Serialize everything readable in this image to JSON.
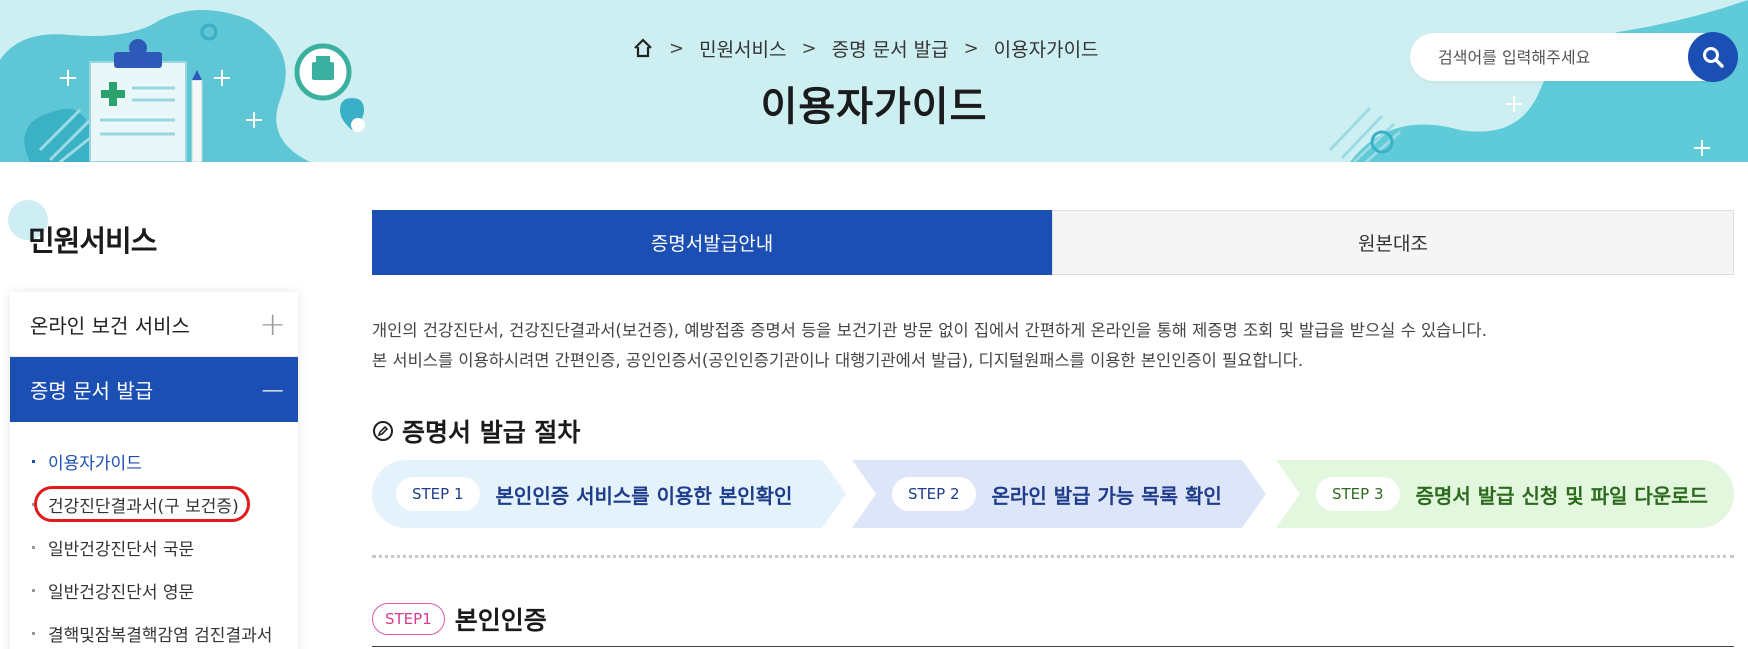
{
  "header": {
    "breadcrumb": [
      "민원서비스",
      "증명 문서 발급",
      "이용자가이드"
    ],
    "title": "이용자가이드",
    "search_placeholder": "검색어를 입력해주세요"
  },
  "sidebar": {
    "title": "민원서비스",
    "items": [
      {
        "label": "온라인 보건 서비스",
        "toggle": "+"
      },
      {
        "label": "증명 문서 발급",
        "toggle": "−"
      }
    ],
    "sub_items": [
      "이용자가이드",
      "건강진단결과서(구 보건증)",
      "일반건강진단서 국문",
      "일반건강진단서 영문",
      "결핵및잠복결핵감염 검진결과서"
    ]
  },
  "tabs": [
    "증명서발급안내",
    "원본대조"
  ],
  "intro": [
    "개인의 건강진단서, 건강진단결과서(보건증), 예방접종 증명서 등을 보건기관 방문 없이 집에서 간편하게 온라인을 통해 제증명 조회 및 발급을 받으실 수 있습니다.",
    "본 서비스를 이용하시려면 간편인증, 공인인증서(공인인증기관이나 대행기관에서 발급), 디지털원패스를 이용한 본인인증이 필요합니다."
  ],
  "procedure": {
    "title": "증명서 발급 절차",
    "steps": [
      {
        "badge": "STEP 1",
        "label": "본인인증 서비스를 이용한 본인확인"
      },
      {
        "badge": "STEP 2",
        "label": "온라인 발급 가능 목록 확인"
      },
      {
        "badge": "STEP 3",
        "label": "증명서 발급 신청 및 파일 다운로드"
      }
    ]
  },
  "step1_section": {
    "badge": "STEP1",
    "title": "본인인증"
  },
  "colors": {
    "primary": "#1c4fb3",
    "banner_bg": "#cdeff1",
    "highlight": "#e01b1b",
    "step1_bg": "#e3f2fb",
    "step2_bg": "#dde6f9",
    "step3_bg": "#e3f6de"
  },
  "icons": [
    "home-icon",
    "search-icon",
    "plus-icon",
    "minus-icon",
    "pencil-icon"
  ]
}
